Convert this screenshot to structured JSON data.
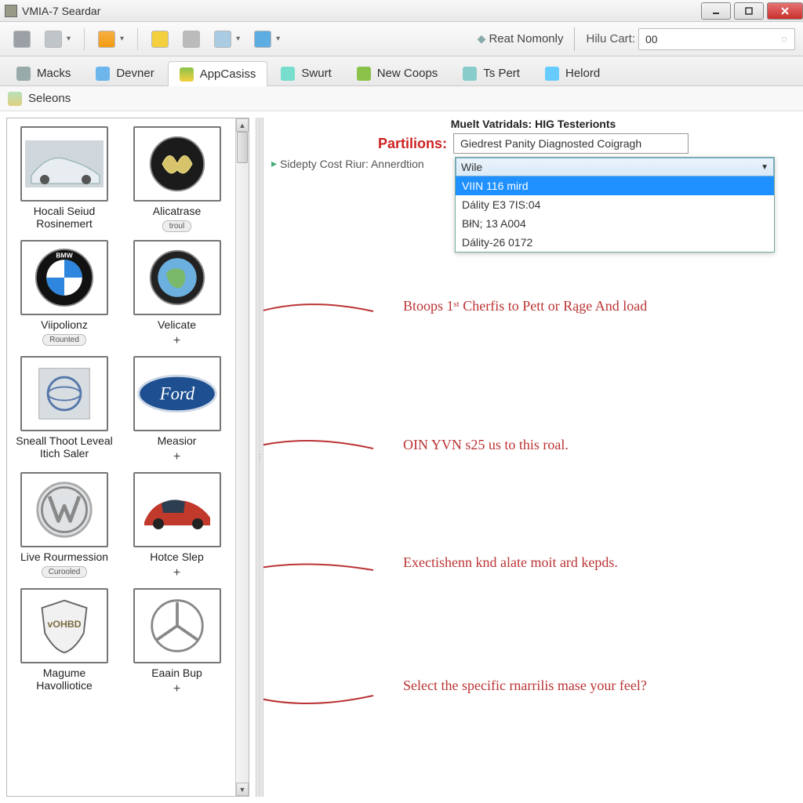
{
  "window": {
    "title": "VMIA-7 Seardar"
  },
  "toolbar": {
    "reat_label": "Reat Nomonly",
    "cart_label": "Hilu Cart:",
    "cart_value": "00"
  },
  "tabs": [
    {
      "label": "Macks",
      "icon_color": "#889"
    },
    {
      "label": "Devner",
      "icon_color": "#3b8fd6"
    },
    {
      "label": "AppCasiss",
      "icon_color": "#6ab04c",
      "active": true
    },
    {
      "label": "Swurt",
      "icon_color": "#5c8"
    },
    {
      "label": "New Coops",
      "icon_color": "#7cb342"
    },
    {
      "label": "Ts Pert",
      "icon_color": "#5aa"
    },
    {
      "label": "Helord",
      "icon_color": "#4aa3df"
    }
  ],
  "subtoolbar": {
    "label": "Seleons"
  },
  "sidebar": {
    "col_left": [
      {
        "label": "Hocali Seiud Rosinemert",
        "kind": "car-photo"
      },
      {
        "label": "Viipolionz",
        "kind": "bmw",
        "subbtn": "Rounted"
      },
      {
        "label": "Sneall Thoot Leveal Itich Saler",
        "kind": "globe-badge"
      },
      {
        "label": "Live Rourmession",
        "kind": "vw",
        "subbtn": "Curooled"
      },
      {
        "label": "Magume Havolliotice",
        "kind": "shield"
      }
    ],
    "col_right": [
      {
        "label": "Alicatrase",
        "kind": "winged",
        "subbtn": "troul"
      },
      {
        "label": "Velicate",
        "kind": "earth",
        "plus": true
      },
      {
        "label": "Measior",
        "kind": "ford",
        "plus": true
      },
      {
        "label": "Hotce Slep",
        "kind": "redcar",
        "plus": true
      },
      {
        "label": "Eaain Bup",
        "kind": "merc",
        "plus": true
      }
    ]
  },
  "panel": {
    "header": "Muelt Vatridals: HIG Testerionts",
    "partilions_label": "Partilions:",
    "partilions_value": "Giedrest Panity Diagnosted Coigragh",
    "breadcrumb": "Sidepty Cost Riur: Annerdtion",
    "dropdown": {
      "top": "Wile",
      "items": [
        {
          "label": "VIIN 116 mird",
          "selected": true
        },
        {
          "label": "Dálity E3 7IS:04"
        },
        {
          "label": "BłN; 13 A004"
        },
        {
          "label": "Dálity-26 0172"
        }
      ]
    }
  },
  "annotations": {
    "a1": "Btoops 1ˢᵗ Cherfis to Pett or Rąge And load",
    "a2": "OIN YVN s25 us to this roal.",
    "a3": "Exectishenn knd alate moit ard kepds.",
    "a4": "Select the specific rnarrilis mase your feel?"
  }
}
